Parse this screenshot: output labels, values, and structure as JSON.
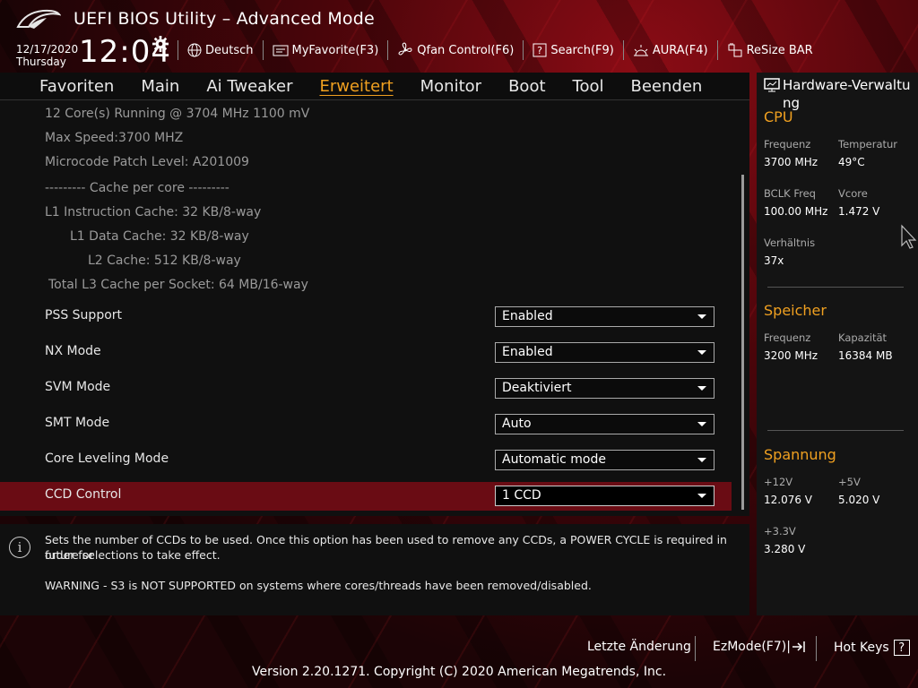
{
  "header": {
    "title": "UEFI BIOS Utility – Advanced Mode",
    "date": "12/17/2020",
    "day": "Thursday",
    "time": "12:04",
    "buttons": [
      {
        "label": "Deutsch",
        "icon": "globe-icon"
      },
      {
        "label": "MyFavorite(F3)",
        "icon": "favorite-icon"
      },
      {
        "label": "Qfan Control(F6)",
        "icon": "fan-icon"
      },
      {
        "label": "Search(F9)",
        "icon": "search-icon"
      },
      {
        "label": "AURA(F4)",
        "icon": "aura-icon"
      },
      {
        "label": "ReSize BAR",
        "icon": "resize-bar-icon"
      }
    ]
  },
  "nav": {
    "tabs": [
      "Favoriten",
      "Main",
      "Ai Tweaker",
      "Erweitert",
      "Monitor",
      "Boot",
      "Tool",
      "Beenden"
    ],
    "active": "Erweitert"
  },
  "main": {
    "info_lines": [
      "12 Core(s) Running @ 3704 MHz  1100 mV",
      "Max Speed:3700 MHZ",
      "Microcode Patch Level: A201009",
      "--------- Cache per core ---------",
      "L1 Instruction Cache: 32 KB/8-way",
      "L1 Data Cache: 32 KB/8-way",
      "L2 Cache: 512 KB/8-way",
      "Total L3 Cache per Socket: 64 MB/16-way"
    ],
    "settings": [
      {
        "label": "PSS Support",
        "value": "Enabled"
      },
      {
        "label": "NX Mode",
        "value": "Enabled"
      },
      {
        "label": "SVM Mode",
        "value": "Deaktiviert"
      },
      {
        "label": "SMT Mode",
        "value": "Auto"
      },
      {
        "label": "Core Leveling Mode",
        "value": "Automatic mode"
      },
      {
        "label": "CCD Control",
        "value": "1 CCD"
      }
    ],
    "selected": "CCD Control"
  },
  "help": {
    "line1": "Sets the number of CCDs to be used. Once this option has been used to remove any CCDs, a POWER CYCLE is required in order for",
    "line2": "future selections to take effect.",
    "warning": "WARNING - S3 is NOT SUPPORTED on systems where cores/threads have been removed/disabled."
  },
  "hardware": {
    "title_a": "Hardware-Verwaltu",
    "title_b": "ng",
    "cpu": {
      "title": "CPU",
      "freq_label": "Frequenz",
      "freq": "3700 MHz",
      "temp_label": "Temperatur",
      "temp": "49°C",
      "bclk_label": "BCLK Freq",
      "bclk": "100.00 MHz",
      "vcore_label": "Vcore",
      "vcore": "1.472 V",
      "ratio_label": "Verhältnis",
      "ratio": "37x"
    },
    "memory": {
      "title": "Speicher",
      "freq_label": "Frequenz",
      "freq": "3200 MHz",
      "cap_label": "Kapazität",
      "cap": "16384 MB"
    },
    "voltage": {
      "title": "Spannung",
      "v12_label": "+12V",
      "v12": "12.076 V",
      "v5_label": "+5V",
      "v5": "5.020 V",
      "v33_label": "+3.3V",
      "v33": "3.280 V"
    }
  },
  "footer": {
    "last_change": "Letzte Änderung",
    "ezmode": "EzMode(F7)|",
    "hotkeys": "Hot Keys",
    "copyright": "Version 2.20.1271. Copyright (C) 2020 American Megatrends, Inc."
  },
  "colors": {
    "accent": "#f0a020",
    "selected_row": "#6a0c14"
  }
}
